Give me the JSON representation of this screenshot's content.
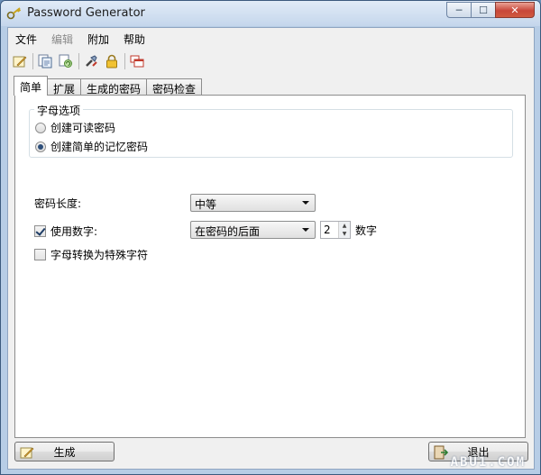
{
  "window": {
    "title": "Password Generator"
  },
  "caption_buttons": {
    "minimize": "─",
    "maximize": "☐",
    "close": "✕"
  },
  "menu": [
    "文件",
    "编辑",
    "附加",
    "帮助"
  ],
  "toolbar": {
    "icons": [
      "generate-icon",
      "copy-icon",
      "refresh-icon",
      "tools-icon",
      "lock-icon",
      "windows-icon"
    ]
  },
  "tabs": [
    "简单",
    "扩展",
    "生成的密码",
    "密码检查"
  ],
  "letter_options": {
    "title": "字母选项",
    "options": [
      "创建可读密码",
      "创建简单的记忆密码"
    ],
    "selected_index": 1
  },
  "password_length": {
    "label": "密码长度:",
    "value": "中等"
  },
  "numbers": {
    "label": "使用数字:",
    "checked": true,
    "position_value": "在密码的后面",
    "count": "2",
    "suffix": "数字"
  },
  "special_chars": {
    "label": "字母转换为特殊字符",
    "checked": false
  },
  "buttons": {
    "generate": "生成",
    "exit": "退出"
  },
  "watermark": "ABU1.COM",
  "colors": {
    "title_bar": "#c4d6ec",
    "close_button": "#c8473a",
    "panel": "#ffffff"
  }
}
